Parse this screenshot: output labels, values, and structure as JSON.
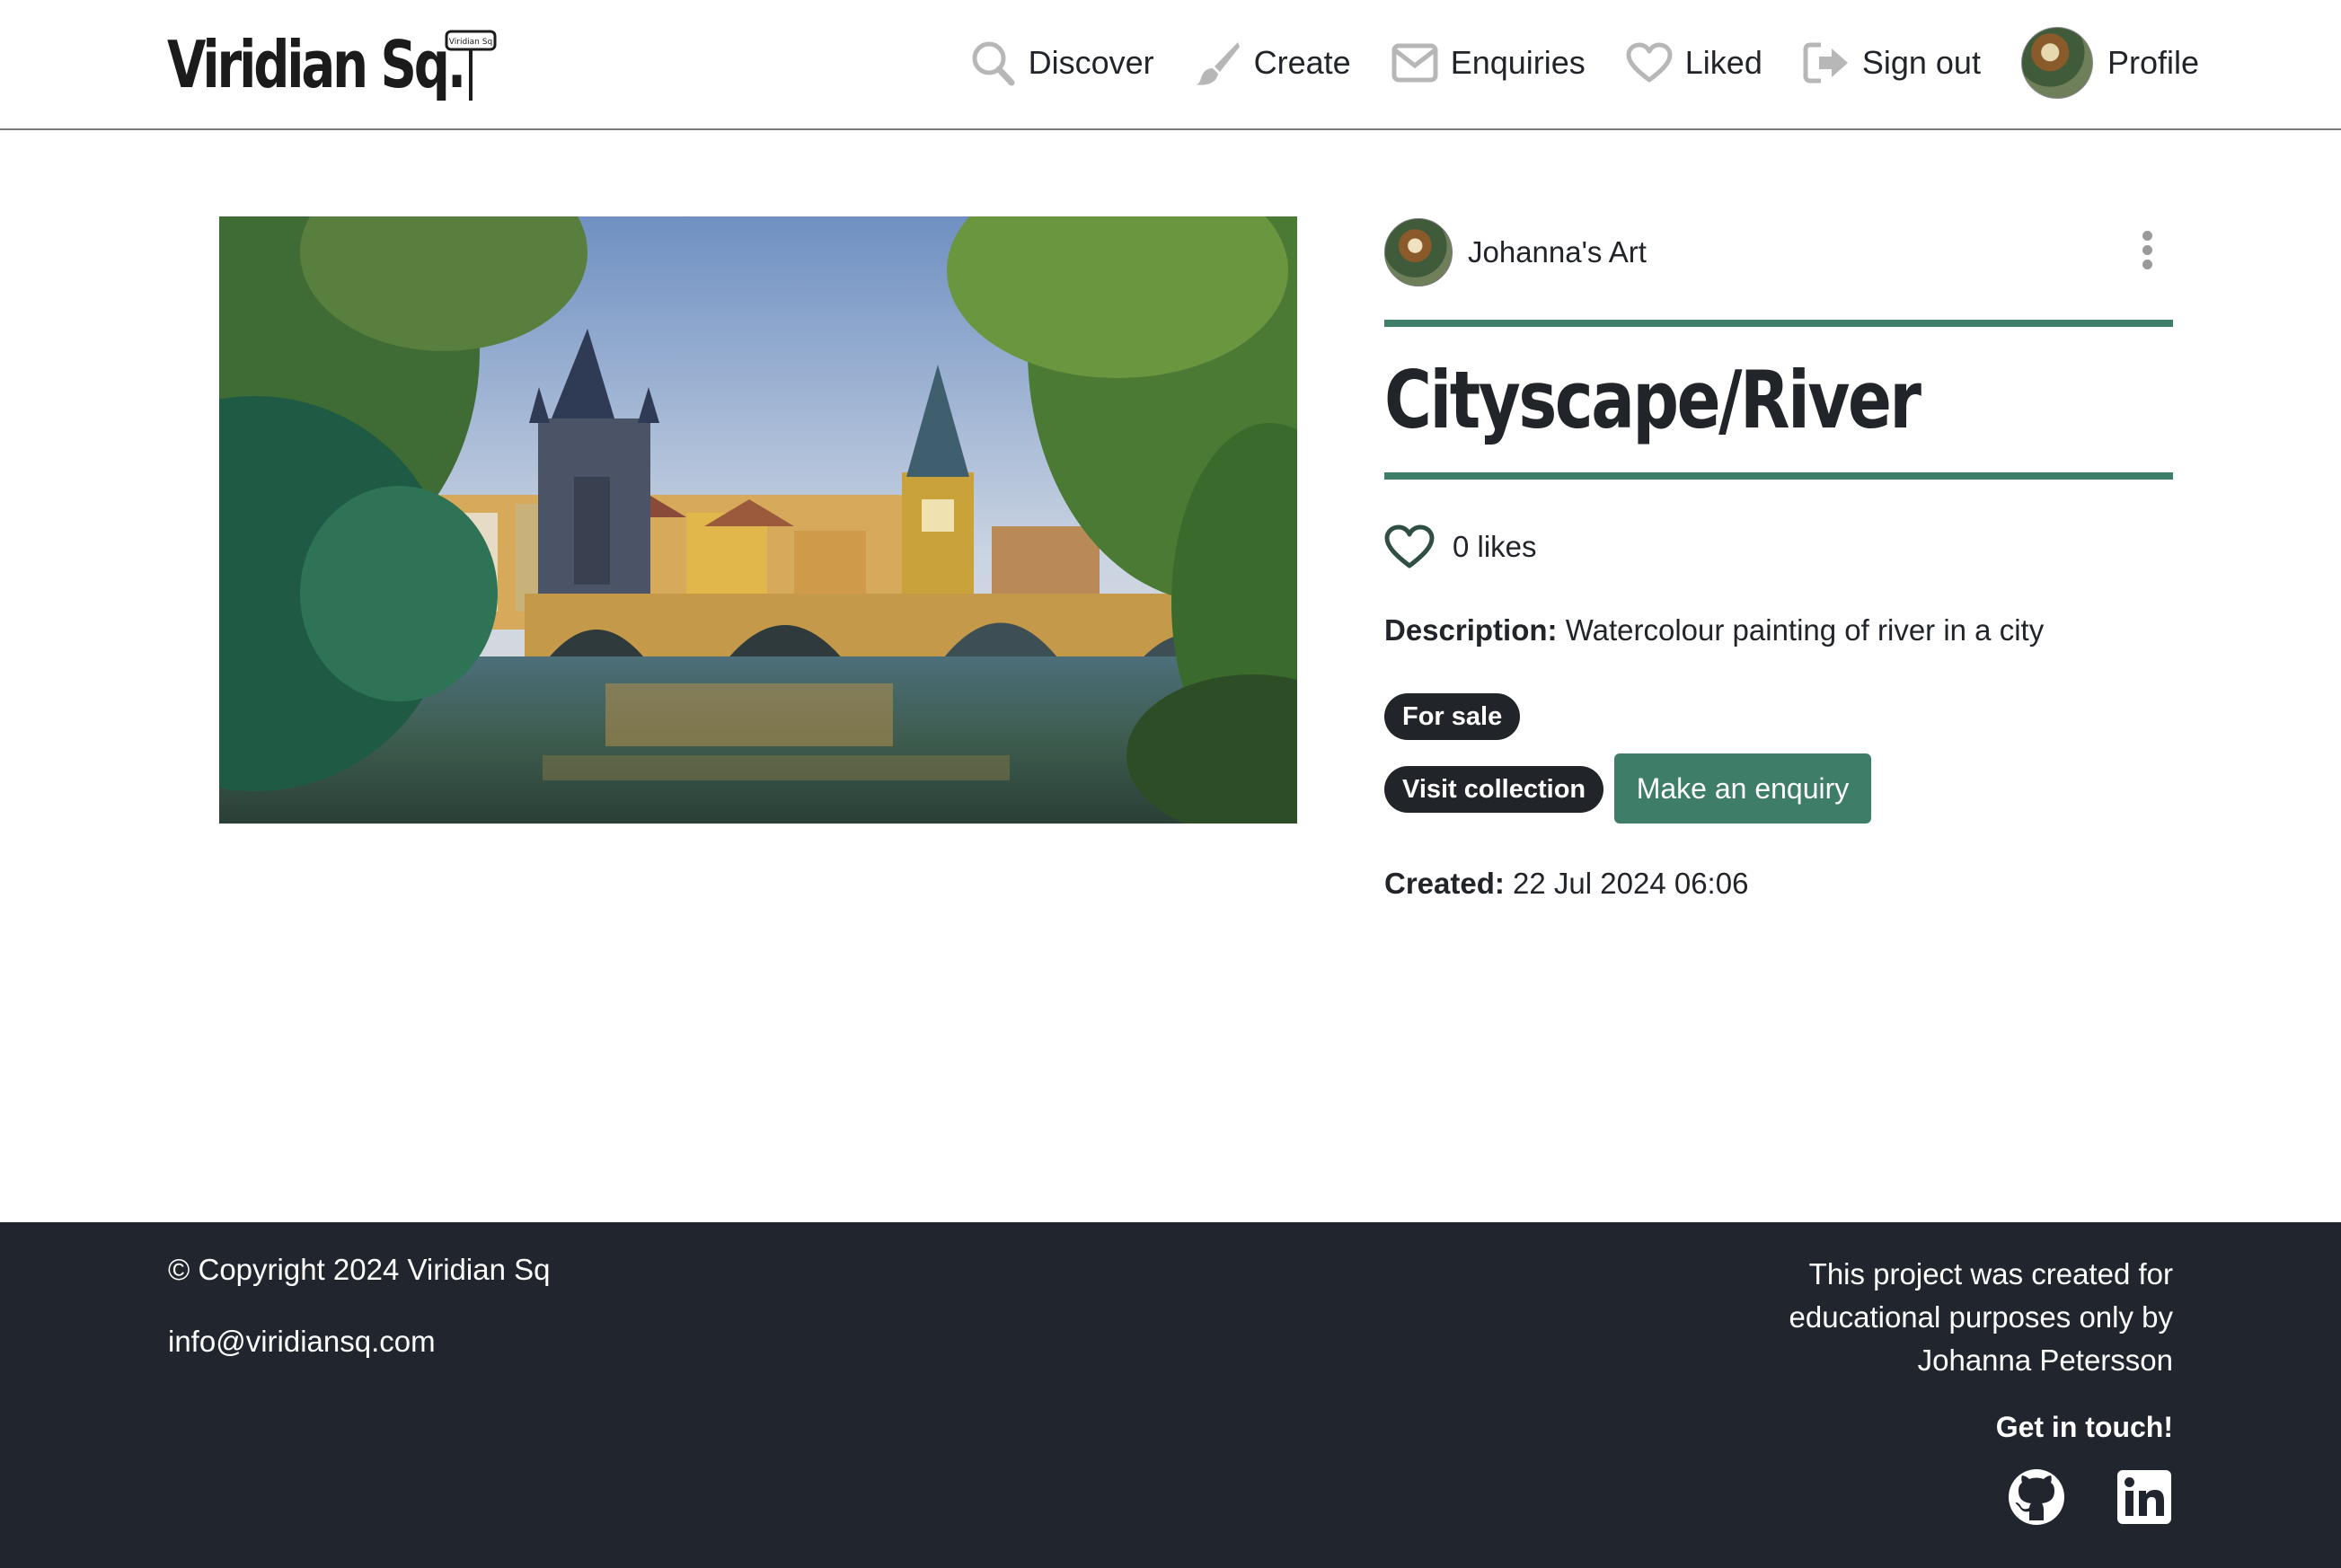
{
  "brand": {
    "name": "Viridian Sq.",
    "sign_text": "Viridian Sq"
  },
  "nav": {
    "items": [
      {
        "label": "Discover",
        "icon": "search-icon"
      },
      {
        "label": "Create",
        "icon": "paintbrush-icon"
      },
      {
        "label": "Enquiries",
        "icon": "envelope-icon"
      },
      {
        "label": "Liked",
        "icon": "heart-icon"
      },
      {
        "label": "Sign out",
        "icon": "sign-out-icon"
      },
      {
        "label": "Profile",
        "icon": "avatar"
      }
    ]
  },
  "artwork": {
    "artist": "Johanna's Art",
    "title": "Cityscape/River",
    "likes": "0 likes",
    "description_label": "Description:",
    "description": "Watercolour painting of river in a city",
    "status_badge": "For sale",
    "visit_collection": "Visit collection",
    "enquiry_button": "Make an enquiry",
    "created_label": "Created:",
    "created": "22 Jul 2024 06:06"
  },
  "footer": {
    "copyright": "© Copyright 2024 Viridian Sq",
    "email": "info@viridiansq.com",
    "credit_line1": "This project was created for",
    "credit_line2": "educational purposes only by",
    "credit_line3": "Johanna Petersson",
    "get_in_touch": "Get in touch!",
    "social": [
      "github-icon",
      "linkedin-icon"
    ]
  },
  "colors": {
    "accent": "#3e7d67",
    "dark": "#212529",
    "footer_bg": "#21262e",
    "icon_grey": "#b7b7b7"
  }
}
